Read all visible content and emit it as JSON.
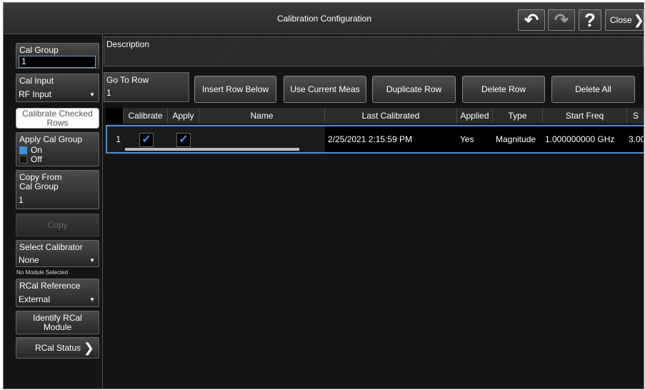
{
  "titlebar": {
    "title": "Calibration Configuration",
    "undo_icon": "↶",
    "redo_icon": "↷",
    "help_label": "?",
    "close_label": "Close",
    "close_chevron": "❯"
  },
  "sidebar": {
    "cal_group": {
      "label": "Cal Group",
      "value": "1"
    },
    "cal_input": {
      "label": "Cal Input",
      "value": "RF Input"
    },
    "calibrate_checked": {
      "line1": "Calibrate Checked",
      "line2": "Rows"
    },
    "apply_cal_group": {
      "label": "Apply Cal Group",
      "on_label": "On",
      "off_label": "Off",
      "state": "On"
    },
    "copy_from": {
      "line1": "Copy From",
      "line2": "Cal Group",
      "value": "1"
    },
    "copy_label": "Copy",
    "select_calibrator": {
      "label": "Select Calibrator",
      "value": "None"
    },
    "no_module_text": "No Module Selected",
    "rcal_reference": {
      "label": "RCal Reference",
      "value": "External"
    },
    "identify_rcal": {
      "line1": "Identify RCal",
      "line2": "Module"
    },
    "rcal_status": {
      "label": "RCal Status",
      "chevron": "❯"
    }
  },
  "main": {
    "description_label": "Description",
    "goto_row": {
      "label": "Go To Row",
      "value": "1"
    },
    "actions": {
      "insert_row_below": "Insert Row Below",
      "use_current_meas": "Use Current Meas",
      "duplicate_row": "Duplicate Row",
      "delete_row": "Delete Row",
      "delete_all": "Delete All"
    },
    "table": {
      "headers": [
        "Calibrate",
        "Apply",
        "Name",
        "Last Calibrated",
        "Applied",
        "Type",
        "Start Freq",
        "S"
      ],
      "rows": [
        {
          "index": "1",
          "calibrate": "✓",
          "apply": "✓",
          "name": "",
          "last_calibrated": "2/25/2021 2:15:59 PM",
          "applied": "Yes",
          "type": "Magnitude",
          "start_freq": "1.000000000 GHz",
          "stop_freq": "3.00"
        }
      ]
    }
  },
  "colors": {
    "accent": "#4d8fd1",
    "check": "#3a9be8",
    "toggle_on": "#3e8fd6",
    "background": "#141414"
  }
}
